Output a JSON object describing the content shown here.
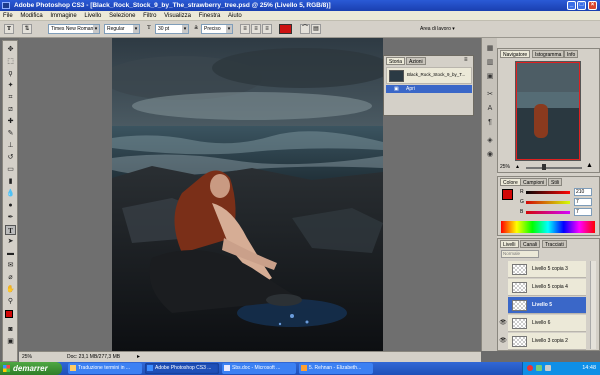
{
  "window": {
    "title": "Adobe Photoshop CS3 - [Black_Rock_Stock_9_by_The_strawberry_tree.psd @ 25% (Livello 5, RGB/8)]"
  },
  "menu": [
    "File",
    "Modifica",
    "Immagine",
    "Livello",
    "Selezione",
    "Filtro",
    "Visualizza",
    "Finestra",
    "Aiuto"
  ],
  "options": {
    "font_family": "Times New Roman",
    "font_style": "Regular",
    "font_size": "30 pt",
    "antialias": "Preciso",
    "workspace": "Area di lavoro",
    "text_color": "#cc1111"
  },
  "history": {
    "tabs": [
      "Storia",
      "Azioni"
    ],
    "snapshot_name": "Black_Rock_Stock_9_by_T...",
    "open_step": "Apri"
  },
  "navigator": {
    "tabs": [
      "Navigatore",
      "Istogramma",
      "Info"
    ],
    "zoom": "25%"
  },
  "color": {
    "tabs": [
      "Colore",
      "Campioni",
      "Stili"
    ],
    "r": "210",
    "g": "7",
    "b": "7",
    "labels": [
      "R",
      "G",
      "B"
    ],
    "foreground": "#d20707"
  },
  "layers": {
    "tabs": [
      "Livelli",
      "Canali",
      "Tracciati"
    ],
    "blend_mode": "Normale",
    "items": [
      {
        "name": "Livello 5 copia 3",
        "visible": false,
        "selected": false
      },
      {
        "name": "Livello 5 copia 4",
        "visible": false,
        "selected": false
      },
      {
        "name": "Livello 5",
        "visible": false,
        "selected": true
      },
      {
        "name": "Livello 6",
        "visible": true,
        "selected": false
      },
      {
        "name": "Livello 3 copia 2",
        "visible": true,
        "selected": false
      }
    ]
  },
  "status": {
    "zoom": "25%",
    "doc": "Doc: 23,1 MB/277,3 MB"
  },
  "taskbar": {
    "start_label": "demarrer",
    "tasks": [
      "Traduzione termini in ...",
      "Adobe Photoshop CS3 ...",
      "Sbs.doc - Microsoft ...",
      "5. Rehnan - Elizabeth..."
    ],
    "clock": "14:48"
  }
}
